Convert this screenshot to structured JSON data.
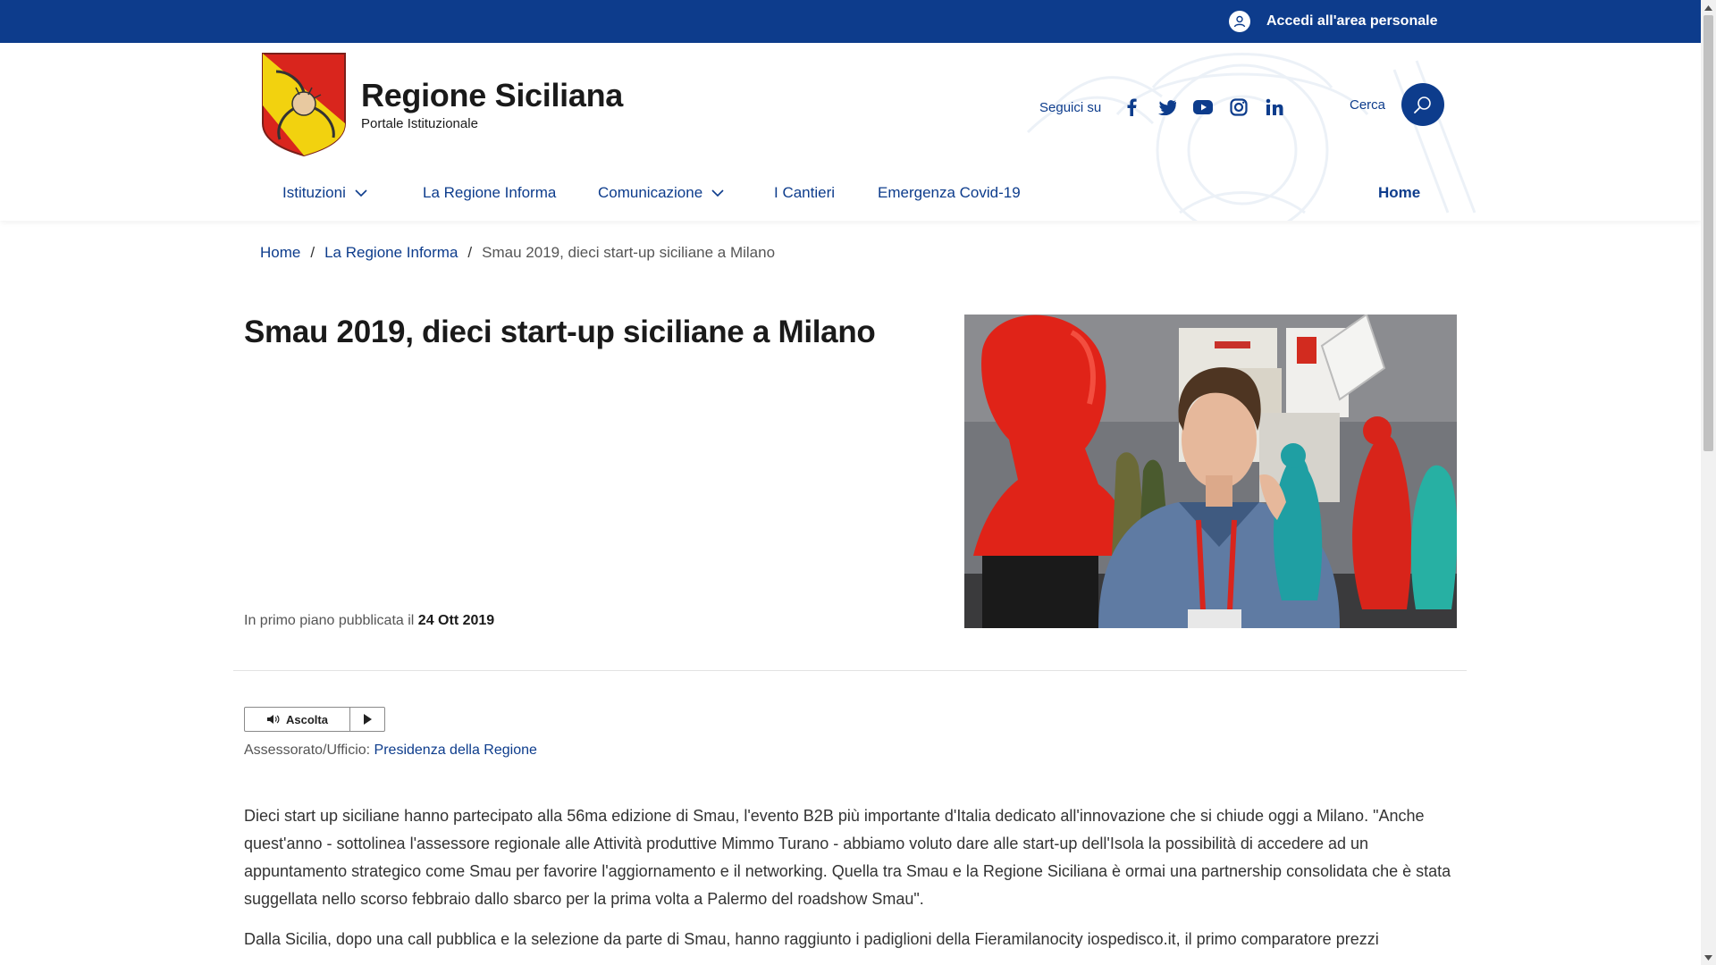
{
  "topbar": {
    "login_label": "Accedi all'area personale"
  },
  "brand": {
    "title": "Regione Siciliana",
    "subtitle": "Portale Istituzionale"
  },
  "social": {
    "label": "Seguici su",
    "icons": [
      "facebook-icon",
      "twitter-icon",
      "youtube-icon",
      "instagram-icon",
      "linkedin-icon"
    ]
  },
  "search": {
    "label": "Cerca"
  },
  "nav": {
    "items": [
      {
        "label": "Istituzioni",
        "dropdown": true
      },
      {
        "label": "La Regione Informa",
        "dropdown": false
      },
      {
        "label": "Comunicazione",
        "dropdown": true
      },
      {
        "label": "I Cantieri",
        "dropdown": false
      },
      {
        "label": "Emergenza Covid-19",
        "dropdown": false
      }
    ],
    "home": "Home"
  },
  "breadcrumb": {
    "items": [
      "Home",
      "La Regione Informa"
    ],
    "separator": "/",
    "current": "Smau 2019, dieci start-up siciliane a Milano"
  },
  "article": {
    "title": "Smau 2019, dieci start-up siciliane a Milano",
    "meta_prefix": "In primo piano pubblicata il",
    "date": "24 Ott 2019",
    "listen_label": "Ascolta",
    "office_label": "Assessorato/Ufficio:",
    "office_link": "Presidenza della Regione",
    "paragraphs": [
      "Dieci start up siciliane hanno partecipato alla 56ma edizione di Smau, l'evento B2B più importante d'Italia dedicato all'innovazione che si chiude oggi a Milano. \"Anche quest'anno - sottolinea l'assessore regionale alle Attività produttive Mimmo Turano - abbiamo voluto dare alle start-up dell'Isola la possibilità di accedere ad un appuntamento strategico come Smau per favorire l'aggiornamento e il networking. Quella tra Smau e la Regione Siciliana è ormai una partnership consolidata che è stata suggellata nello scorso febbraio dallo sbarco per la prima volta a Palermo del roadshow Smau\".",
      "Dalla Sicilia, dopo una call pubblica e la selezione da parte di Smau, hanno raggiunto i padiglioni della Fieramilanocity iospedisco.it, il primo comparatore prezzi"
    ]
  },
  "colors": {
    "primary": "#0d3c8c",
    "crest_yellow": "#f2d20f",
    "crest_red": "#d9251d"
  }
}
